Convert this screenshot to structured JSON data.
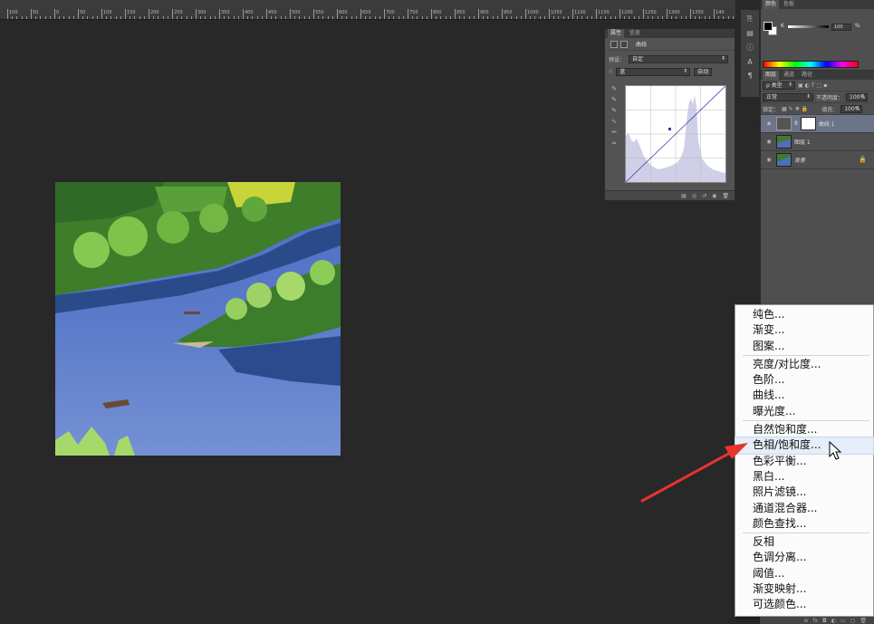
{
  "ruler": {
    "labels": [
      "100",
      "50",
      "0",
      "50",
      "100",
      "150",
      "200",
      "250",
      "300",
      "350",
      "400",
      "450",
      "500",
      "550",
      "600",
      "650",
      "700",
      "750",
      "800",
      "850",
      "900",
      "950",
      "1000",
      "1050",
      "1100",
      "1150",
      "1200",
      "1250",
      "1300",
      "1350",
      "140"
    ]
  },
  "properties": {
    "tabs": [
      "属性",
      "信息"
    ],
    "title": "曲线",
    "preset_label": "预设：",
    "preset_value": "自定",
    "channel_value": "蓝",
    "auto_button": "自动"
  },
  "color_panel": {
    "tabs": [
      "颜色",
      "色板"
    ],
    "k_label": "K",
    "k_value": "100",
    "k_unit": "%"
  },
  "layers_panel": {
    "tabs": [
      "图层",
      "通道",
      "路径"
    ],
    "kind_filter": "ρ 类型",
    "blend_mode": "正常",
    "opacity_label": "不透明度：",
    "opacity_value": "100%",
    "lock_label": "锁定：",
    "fill_label": "填充：",
    "fill_value": "100%",
    "layers": [
      {
        "name": "曲线 1"
      },
      {
        "name": "图层 1"
      },
      {
        "name": "背景"
      }
    ]
  },
  "menu": {
    "group1": [
      "纯色...",
      "渐变...",
      "图案..."
    ],
    "group2": [
      "亮度/对比度...",
      "色阶...",
      "曲线...",
      "曝光度..."
    ],
    "group3": [
      "自然饱和度...",
      "色相/饱和度...",
      "色彩平衡...",
      "黑白...",
      "照片滤镜...",
      "通道混合器...",
      "颜色查找..."
    ],
    "group4": [
      "反相",
      "色调分离...",
      "阈值...",
      "渐变映射...",
      "可选颜色..."
    ],
    "highlighted": "色相/饱和度..."
  },
  "colors": {
    "annotation_arrow": "#e8332e",
    "menu_highlight": "#e5eef9",
    "curve_line": "#3a3aa0"
  }
}
